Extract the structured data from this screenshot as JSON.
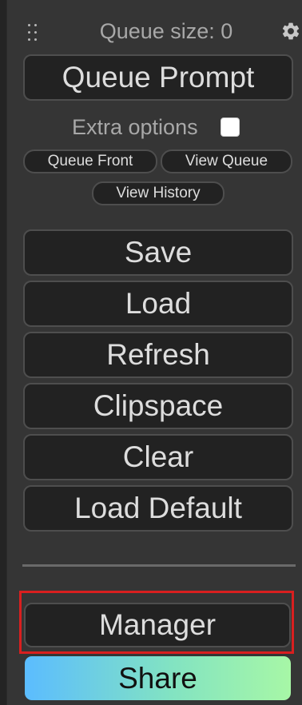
{
  "header": {
    "queue_size_text": "Queue size: 0"
  },
  "buttons": {
    "queue_prompt": "Queue Prompt",
    "queue_front": "Queue Front",
    "view_queue": "View Queue",
    "view_history": "View History",
    "save": "Save",
    "load": "Load",
    "refresh": "Refresh",
    "clipspace": "Clipspace",
    "clear": "Clear",
    "load_default": "Load Default",
    "manager": "Manager",
    "share": "Share"
  },
  "extra_options": {
    "label": "Extra options",
    "checked": false
  },
  "icons": {
    "drag_handle": "drag-handle-icon",
    "settings": "gear-icon"
  },
  "colors": {
    "panel_bg": "#353535",
    "button_bg": "#222222",
    "highlight_border": "#d91f1f",
    "share_gradient_start": "#5bbcff",
    "share_gradient_end": "#a7f7a6"
  }
}
